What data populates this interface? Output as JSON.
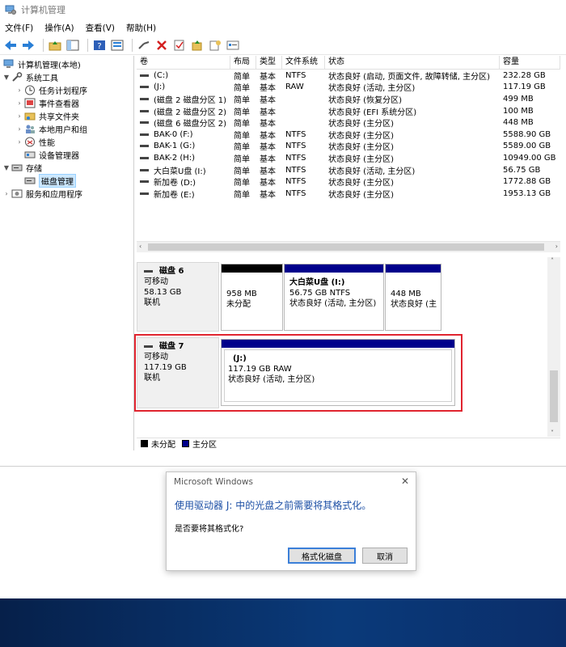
{
  "window": {
    "title": "计算机管理",
    "menu": [
      "文件(F)",
      "操作(A)",
      "查看(V)",
      "帮助(H)"
    ]
  },
  "tree": {
    "root": "计算机管理(本地)",
    "system_tools": "系统工具",
    "items": [
      "任务计划程序",
      "事件查看器",
      "共享文件夹",
      "本地用户和组",
      "性能",
      "设备管理器"
    ],
    "storage": "存储",
    "disk_management": "磁盘管理",
    "services": "服务和应用程序"
  },
  "volume_list": {
    "headers": [
      "卷",
      "布局",
      "类型",
      "文件系统",
      "状态",
      "容量"
    ],
    "rows": [
      [
        "(C:)",
        "简单",
        "基本",
        "NTFS",
        "状态良好 (启动, 页面文件, 故障转储, 主分区)",
        "232.28 GB"
      ],
      [
        "(J:)",
        "简单",
        "基本",
        "RAW",
        "状态良好 (活动, 主分区)",
        "117.19 GB"
      ],
      [
        "(磁盘 2 磁盘分区 1)",
        "简单",
        "基本",
        "",
        "状态良好 (恢复分区)",
        "499 MB"
      ],
      [
        "(磁盘 2 磁盘分区 2)",
        "简单",
        "基本",
        "",
        "状态良好 (EFI 系统分区)",
        "100 MB"
      ],
      [
        "(磁盘 6 磁盘分区 2)",
        "简单",
        "基本",
        "",
        "状态良好 (主分区)",
        "448 MB"
      ],
      [
        "BAK-0 (F:)",
        "简单",
        "基本",
        "NTFS",
        "状态良好 (主分区)",
        "5588.90 GB"
      ],
      [
        "BAK-1 (G:)",
        "简单",
        "基本",
        "NTFS",
        "状态良好 (主分区)",
        "5589.00 GB"
      ],
      [
        "BAK-2 (H:)",
        "简单",
        "基本",
        "NTFS",
        "状态良好 (主分区)",
        "10949.00 GB"
      ],
      [
        "大白菜U盘 (I:)",
        "简单",
        "基本",
        "NTFS",
        "状态良好 (活动, 主分区)",
        "56.75 GB"
      ],
      [
        "新加卷 (D:)",
        "简单",
        "基本",
        "NTFS",
        "状态良好 (主分区)",
        "1772.88 GB"
      ],
      [
        "新加卷 (E:)",
        "简单",
        "基本",
        "NTFS",
        "状态良好 (主分区)",
        "1953.13 GB"
      ]
    ]
  },
  "disk6": {
    "name": "磁盘 6",
    "type": "可移动",
    "size": "58.13 GB",
    "status": "联机",
    "p1_size": "958 MB",
    "p1_state": "未分配",
    "p2_name": "大白菜U盘 (I:)",
    "p2_size": "56.75 GB NTFS",
    "p2_state": "状态良好 (活动, 主分区)",
    "p3_size": "448 MB",
    "p3_state": "状态良好 (主"
  },
  "disk7": {
    "name": "磁盘 7",
    "type": "可移动",
    "size": "117.19 GB",
    "status": "联机",
    "p_name": "(J:)",
    "p_size": "117.19 GB RAW",
    "p_state": "状态良好 (活动, 主分区)"
  },
  "legend": {
    "unallocated": "未分配",
    "primary": "主分区"
  },
  "dialog": {
    "title": "Microsoft Windows",
    "message": "使用驱动器 J: 中的光盘之前需要将其格式化。",
    "question": "是否要将其格式化?",
    "format_button": "格式化磁盘",
    "cancel_button": "取消"
  },
  "colors": {
    "primary_partition": "#00008b",
    "unallocated": "#000000",
    "highlight": "#e0242f",
    "dialog_text": "#1c4fa5"
  }
}
